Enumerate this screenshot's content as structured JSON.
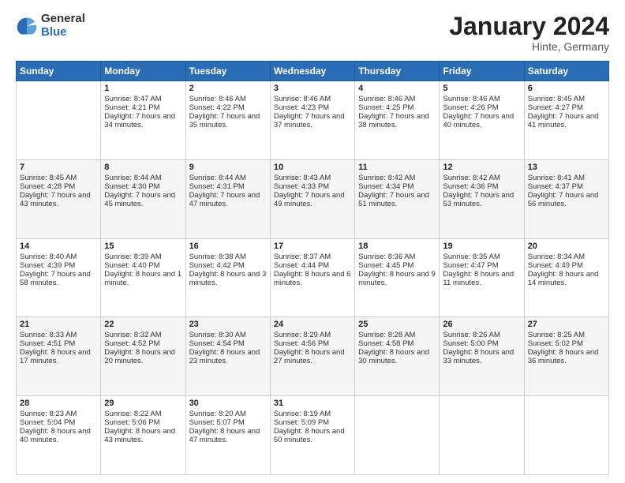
{
  "logo": {
    "general": "General",
    "blue": "Blue"
  },
  "title": "January 2024",
  "location": "Hinte, Germany",
  "days_header": [
    "Sunday",
    "Monday",
    "Tuesday",
    "Wednesday",
    "Thursday",
    "Friday",
    "Saturday"
  ],
  "weeks": [
    [
      {
        "day": "",
        "sunrise": "",
        "sunset": "",
        "daylight": ""
      },
      {
        "day": "1",
        "sunrise": "Sunrise: 8:47 AM",
        "sunset": "Sunset: 4:21 PM",
        "daylight": "Daylight: 7 hours and 34 minutes."
      },
      {
        "day": "2",
        "sunrise": "Sunrise: 8:46 AM",
        "sunset": "Sunset: 4:22 PM",
        "daylight": "Daylight: 7 hours and 35 minutes."
      },
      {
        "day": "3",
        "sunrise": "Sunrise: 8:46 AM",
        "sunset": "Sunset: 4:23 PM",
        "daylight": "Daylight: 7 hours and 37 minutes."
      },
      {
        "day": "4",
        "sunrise": "Sunrise: 8:46 AM",
        "sunset": "Sunset: 4:25 PM",
        "daylight": "Daylight: 7 hours and 38 minutes."
      },
      {
        "day": "5",
        "sunrise": "Sunrise: 8:46 AM",
        "sunset": "Sunset: 4:26 PM",
        "daylight": "Daylight: 7 hours and 40 minutes."
      },
      {
        "day": "6",
        "sunrise": "Sunrise: 8:45 AM",
        "sunset": "Sunset: 4:27 PM",
        "daylight": "Daylight: 7 hours and 41 minutes."
      }
    ],
    [
      {
        "day": "7",
        "sunrise": "Sunrise: 8:45 AM",
        "sunset": "Sunset: 4:28 PM",
        "daylight": "Daylight: 7 hours and 43 minutes."
      },
      {
        "day": "8",
        "sunrise": "Sunrise: 8:44 AM",
        "sunset": "Sunset: 4:30 PM",
        "daylight": "Daylight: 7 hours and 45 minutes."
      },
      {
        "day": "9",
        "sunrise": "Sunrise: 8:44 AM",
        "sunset": "Sunset: 4:31 PM",
        "daylight": "Daylight: 7 hours and 47 minutes."
      },
      {
        "day": "10",
        "sunrise": "Sunrise: 8:43 AM",
        "sunset": "Sunset: 4:33 PM",
        "daylight": "Daylight: 7 hours and 49 minutes."
      },
      {
        "day": "11",
        "sunrise": "Sunrise: 8:42 AM",
        "sunset": "Sunset: 4:34 PM",
        "daylight": "Daylight: 7 hours and 51 minutes."
      },
      {
        "day": "12",
        "sunrise": "Sunrise: 8:42 AM",
        "sunset": "Sunset: 4:36 PM",
        "daylight": "Daylight: 7 hours and 53 minutes."
      },
      {
        "day": "13",
        "sunrise": "Sunrise: 8:41 AM",
        "sunset": "Sunset: 4:37 PM",
        "daylight": "Daylight: 7 hours and 56 minutes."
      }
    ],
    [
      {
        "day": "14",
        "sunrise": "Sunrise: 8:40 AM",
        "sunset": "Sunset: 4:39 PM",
        "daylight": "Daylight: 7 hours and 58 minutes."
      },
      {
        "day": "15",
        "sunrise": "Sunrise: 8:39 AM",
        "sunset": "Sunset: 4:40 PM",
        "daylight": "Daylight: 8 hours and 1 minute."
      },
      {
        "day": "16",
        "sunrise": "Sunrise: 8:38 AM",
        "sunset": "Sunset: 4:42 PM",
        "daylight": "Daylight: 8 hours and 3 minutes."
      },
      {
        "day": "17",
        "sunrise": "Sunrise: 8:37 AM",
        "sunset": "Sunset: 4:44 PM",
        "daylight": "Daylight: 8 hours and 6 minutes."
      },
      {
        "day": "18",
        "sunrise": "Sunrise: 8:36 AM",
        "sunset": "Sunset: 4:45 PM",
        "daylight": "Daylight: 8 hours and 9 minutes."
      },
      {
        "day": "19",
        "sunrise": "Sunrise: 8:35 AM",
        "sunset": "Sunset: 4:47 PM",
        "daylight": "Daylight: 8 hours and 11 minutes."
      },
      {
        "day": "20",
        "sunrise": "Sunrise: 8:34 AM",
        "sunset": "Sunset: 4:49 PM",
        "daylight": "Daylight: 8 hours and 14 minutes."
      }
    ],
    [
      {
        "day": "21",
        "sunrise": "Sunrise: 8:33 AM",
        "sunset": "Sunset: 4:51 PM",
        "daylight": "Daylight: 8 hours and 17 minutes."
      },
      {
        "day": "22",
        "sunrise": "Sunrise: 8:32 AM",
        "sunset": "Sunset: 4:52 PM",
        "daylight": "Daylight: 8 hours and 20 minutes."
      },
      {
        "day": "23",
        "sunrise": "Sunrise: 8:30 AM",
        "sunset": "Sunset: 4:54 PM",
        "daylight": "Daylight: 8 hours and 23 minutes."
      },
      {
        "day": "24",
        "sunrise": "Sunrise: 8:29 AM",
        "sunset": "Sunset: 4:56 PM",
        "daylight": "Daylight: 8 hours and 27 minutes."
      },
      {
        "day": "25",
        "sunrise": "Sunrise: 8:28 AM",
        "sunset": "Sunset: 4:58 PM",
        "daylight": "Daylight: 8 hours and 30 minutes."
      },
      {
        "day": "26",
        "sunrise": "Sunrise: 8:26 AM",
        "sunset": "Sunset: 5:00 PM",
        "daylight": "Daylight: 8 hours and 33 minutes."
      },
      {
        "day": "27",
        "sunrise": "Sunrise: 8:25 AM",
        "sunset": "Sunset: 5:02 PM",
        "daylight": "Daylight: 8 hours and 36 minutes."
      }
    ],
    [
      {
        "day": "28",
        "sunrise": "Sunrise: 8:23 AM",
        "sunset": "Sunset: 5:04 PM",
        "daylight": "Daylight: 8 hours and 40 minutes."
      },
      {
        "day": "29",
        "sunrise": "Sunrise: 8:22 AM",
        "sunset": "Sunset: 5:06 PM",
        "daylight": "Daylight: 8 hours and 43 minutes."
      },
      {
        "day": "30",
        "sunrise": "Sunrise: 8:20 AM",
        "sunset": "Sunset: 5:07 PM",
        "daylight": "Daylight: 8 hours and 47 minutes."
      },
      {
        "day": "31",
        "sunrise": "Sunrise: 8:19 AM",
        "sunset": "Sunset: 5:09 PM",
        "daylight": "Daylight: 8 hours and 50 minutes."
      },
      {
        "day": "",
        "sunrise": "",
        "sunset": "",
        "daylight": ""
      },
      {
        "day": "",
        "sunrise": "",
        "sunset": "",
        "daylight": ""
      },
      {
        "day": "",
        "sunrise": "",
        "sunset": "",
        "daylight": ""
      }
    ]
  ]
}
